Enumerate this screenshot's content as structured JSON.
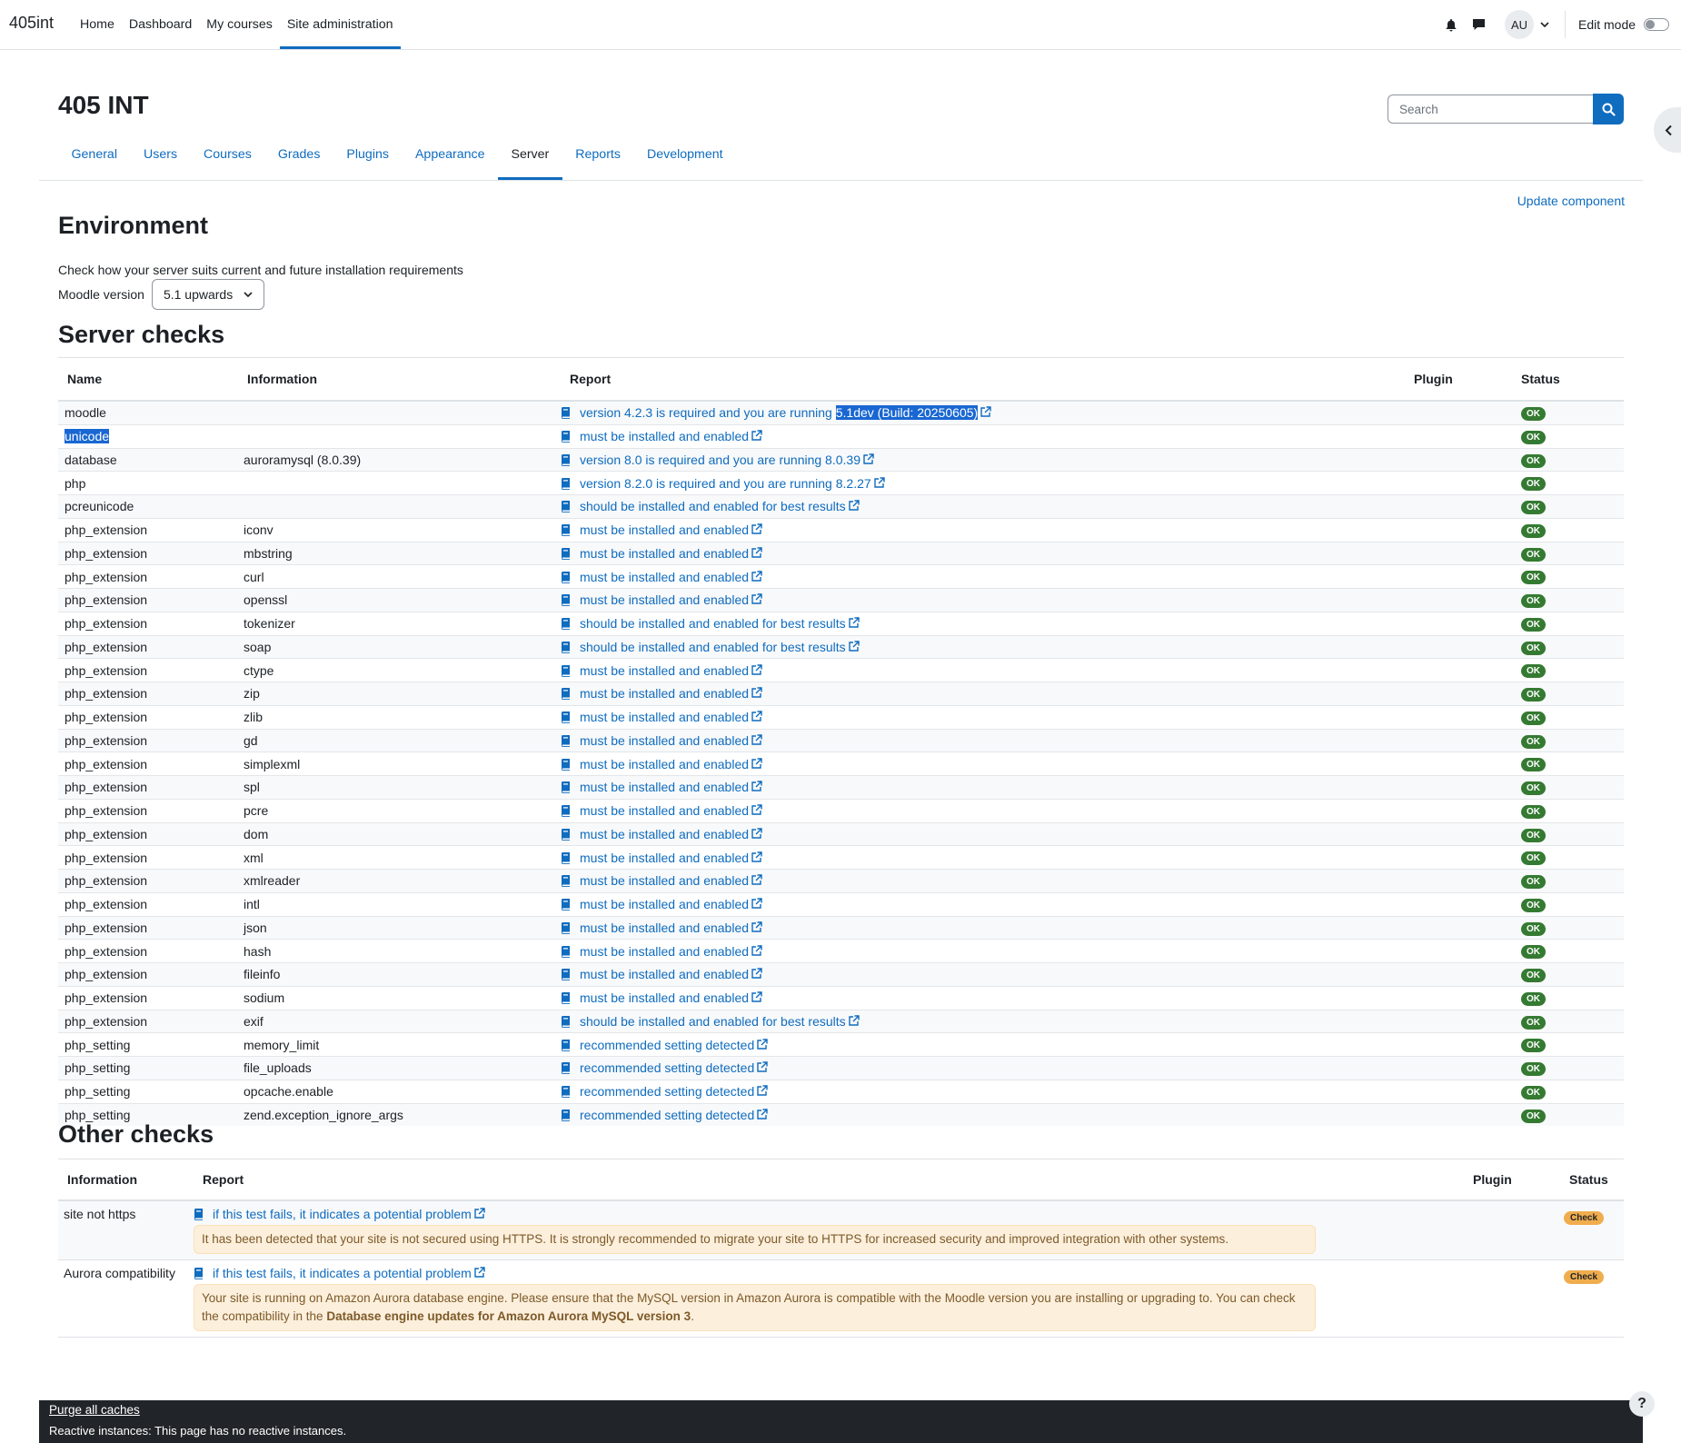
{
  "navbar": {
    "brand": "405int",
    "primary_nav": [
      "Home",
      "Dashboard",
      "My courses",
      "Site administration"
    ],
    "active_nav": "Site administration",
    "avatar_initials": "AU",
    "edit_mode_label": "Edit mode",
    "icons": [
      "bell-icon",
      "chat-bubble-icon",
      "chevron-down-icon"
    ]
  },
  "header": {
    "title": "405 INT",
    "search_placeholder": "Search"
  },
  "tabs": [
    "General",
    "Users",
    "Courses",
    "Grades",
    "Plugins",
    "Appearance",
    "Server",
    "Reports",
    "Development"
  ],
  "active_tab": "Server",
  "update_component": "Update component",
  "environment": {
    "heading": "Environment",
    "intro": "Check how your server suits current and future installation requirements",
    "version_label": "Moodle version",
    "version_value": "5.1 upwards"
  },
  "server_checks": {
    "heading": "Server checks",
    "columns": [
      "Name",
      "Information",
      "Report",
      "Plugin",
      "Status"
    ],
    "rows": [
      {
        "name": "moodle",
        "info": "",
        "report": "version 4.2.3 is required and you are running ",
        "report_sel": "5.1dev (Build: 20250605)",
        "status": "OK"
      },
      {
        "name": "unicode",
        "name_selected": true,
        "info": "",
        "report": "must be installed and enabled",
        "status": "OK"
      },
      {
        "name": "database",
        "info": "auroramysql (8.0.39)",
        "report": "version 8.0 is required and you are running 8.0.39",
        "status": "OK"
      },
      {
        "name": "php",
        "info": "",
        "report": "version 8.2.0 is required and you are running 8.2.27",
        "status": "OK"
      },
      {
        "name": "pcreunicode",
        "info": "",
        "report": "should be installed and enabled for best results",
        "status": "OK"
      },
      {
        "name": "php_extension",
        "info": "iconv",
        "report": "must be installed and enabled",
        "status": "OK"
      },
      {
        "name": "php_extension",
        "info": "mbstring",
        "report": "must be installed and enabled",
        "status": "OK"
      },
      {
        "name": "php_extension",
        "info": "curl",
        "report": "must be installed and enabled",
        "status": "OK"
      },
      {
        "name": "php_extension",
        "info": "openssl",
        "report": "must be installed and enabled",
        "status": "OK"
      },
      {
        "name": "php_extension",
        "info": "tokenizer",
        "report": "should be installed and enabled for best results",
        "status": "OK"
      },
      {
        "name": "php_extension",
        "info": "soap",
        "report": "should be installed and enabled for best results",
        "status": "OK"
      },
      {
        "name": "php_extension",
        "info": "ctype",
        "report": "must be installed and enabled",
        "status": "OK"
      },
      {
        "name": "php_extension",
        "info": "zip",
        "report": "must be installed and enabled",
        "status": "OK"
      },
      {
        "name": "php_extension",
        "info": "zlib",
        "report": "must be installed and enabled",
        "status": "OK"
      },
      {
        "name": "php_extension",
        "info": "gd",
        "report": "must be installed and enabled",
        "status": "OK"
      },
      {
        "name": "php_extension",
        "info": "simplexml",
        "report": "must be installed and enabled",
        "status": "OK"
      },
      {
        "name": "php_extension",
        "info": "spl",
        "report": "must be installed and enabled",
        "status": "OK"
      },
      {
        "name": "php_extension",
        "info": "pcre",
        "report": "must be installed and enabled",
        "status": "OK"
      },
      {
        "name": "php_extension",
        "info": "dom",
        "report": "must be installed and enabled",
        "status": "OK"
      },
      {
        "name": "php_extension",
        "info": "xml",
        "report": "must be installed and enabled",
        "status": "OK"
      },
      {
        "name": "php_extension",
        "info": "xmlreader",
        "report": "must be installed and enabled",
        "status": "OK"
      },
      {
        "name": "php_extension",
        "info": "intl",
        "report": "must be installed and enabled",
        "status": "OK"
      },
      {
        "name": "php_extension",
        "info": "json",
        "report": "must be installed and enabled",
        "status": "OK"
      },
      {
        "name": "php_extension",
        "info": "hash",
        "report": "must be installed and enabled",
        "status": "OK"
      },
      {
        "name": "php_extension",
        "info": "fileinfo",
        "report": "must be installed and enabled",
        "status": "OK"
      },
      {
        "name": "php_extension",
        "info": "sodium",
        "report": "must be installed and enabled",
        "status": "OK"
      },
      {
        "name": "php_extension",
        "info": "exif",
        "report": "should be installed and enabled for best results",
        "status": "OK"
      },
      {
        "name": "php_setting",
        "info": "memory_limit",
        "report": "recommended setting detected",
        "status": "OK"
      },
      {
        "name": "php_setting",
        "info": "file_uploads",
        "report": "recommended setting detected",
        "status": "OK"
      },
      {
        "name": "php_setting",
        "info": "opcache.enable",
        "report": "recommended setting detected",
        "status": "OK"
      },
      {
        "name": "php_setting",
        "info": "zend.exception_ignore_args",
        "report": "recommended setting detected",
        "status": "OK"
      }
    ]
  },
  "other_checks": {
    "heading": "Other checks",
    "columns": [
      "Information",
      "Report",
      "Plugin",
      "Status"
    ],
    "rows": [
      {
        "info": "site not https",
        "report": "if this test fails, it indicates a potential problem",
        "message": "It has been detected that your site is not secured using HTTPS. It is strongly recommended to migrate your site to HTTPS for increased security and improved integration with other systems.",
        "message_bold": "",
        "message_tail": "",
        "status": "Check"
      },
      {
        "info": "Aurora compatibility",
        "report": "if this test fails, it indicates a potential problem",
        "message": "Your site is running on Amazon Aurora database engine. Please ensure that the MySQL version in Amazon Aurora is compatible with the Moodle version you are installing or upgrading to. You can check the compatibility in the ",
        "message_bold": "Database engine updates for Amazon Aurora MySQL version 3",
        "message_tail": ".",
        "status": "Check"
      }
    ]
  },
  "footer": {
    "purge_caches": "Purge all caches",
    "reactive": "Reactive instances: This page has no reactive instances.",
    "help": "?"
  },
  "colors": {
    "link": "#0f6cbf",
    "ok_badge": "#357a32",
    "check_badge": "#f0ad4e",
    "footer_bg": "#212529"
  }
}
